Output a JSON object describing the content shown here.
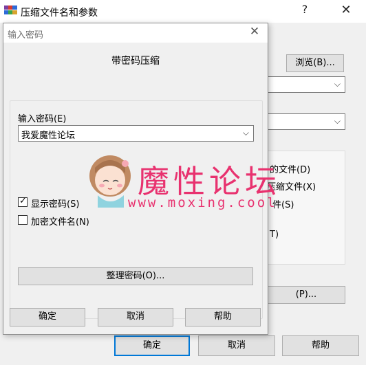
{
  "parent": {
    "title": "压缩文件名和参数",
    "help_glyph": "?",
    "close_glyph": "✕",
    "browse_label": "浏览(B)...",
    "option_1": "的文件(D)",
    "option_2": "压缩文件(X)",
    "option_3": "件(S)",
    "option_4": "T)",
    "btn_p_label": "(P)...",
    "ok_label": "确定",
    "cancel_label": "取消",
    "help_label": "帮助"
  },
  "dialog": {
    "title": "输入密码",
    "close_glyph": "✕",
    "heading": "带密码压缩",
    "password_label": "输入密码(E)",
    "password_value": "我爱魔性论坛",
    "show_password_label": "显示密码(S)",
    "show_password_checked": true,
    "encrypt_names_label": "加密文件名(N)",
    "encrypt_names_checked": false,
    "organize_label": "整理密码(O)...",
    "ok_label": "确定",
    "cancel_label": "取消",
    "help_label": "帮助"
  },
  "watermark": {
    "text": "魔性论坛",
    "url": "www.moxing.cool"
  },
  "icons": {
    "chevron": "⌵",
    "check": "✓"
  },
  "colors": {
    "accent": "#0078d7",
    "watermark": "#e8326f"
  }
}
